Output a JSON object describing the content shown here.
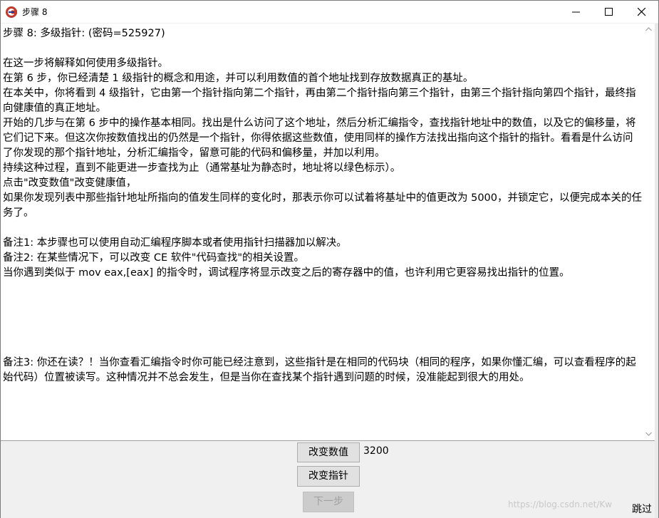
{
  "window": {
    "title": "步骤 8",
    "app_icon": "cheat-engine-logo-icon",
    "controls": {
      "minimize": "minimize-icon",
      "maximize": "maximize-icon",
      "close": "close-icon"
    }
  },
  "tutorial": {
    "text": "步骤 8: 多级指针: (密码=525927)\n\n在这一步将解释如何使用多级指针。\n在第 6 步，你已经清楚 1 级指针的概念和用途，并可以利用数值的首个地址找到存放数据真正的基址。\n在本关中，你将看到 4 级指针，它由第一个指针指向第二个指针，再由第二个指针指向第三个指针，由第三个指针指向第四个指针，最终指向健康值的真正地址。\n开始的几步与在第 6 步中的操作基本相同。找出是什么访问了这个地址，然后分析汇编指令，查找指针地址中的数值，以及它的偏移量，将它们记下来。但这次你按数值找出的仍然是一个指针，你得依据这些数值，使用同样的操作方法找出指向这个指针的指针。看看是什么访问了你发现的那个指针地址，分析汇编指令，留意可能的代码和偏移量，并加以利用。\n持续这种过程，直到不能更进一步查找为止（通常基址为静态时，地址将以绿色标示）。\n点击\"改变数值\"改变健康值，\n如果你发现列表中那些指针地址所指向的值发生同样的变化时，那表示你可以试着将基址中的值更改为 5000，并锁定它，以便完成本关的任务了。\n\n备注1: 本步骤也可以使用自动汇编程序脚本或者使用指针扫描器加以解决。\n备注2: 在某些情况下，可以改变 CE 软件\"代码查找\"的相关设置。\n当你遇到类似于 mov eax,[eax] 的指令时，调试程序将显示改变之后的寄存器中的值，也许利用它更容易找出指针的位置。\n\n\n\n\n\n备注3: 你还在读？！当你查看汇编指令时你可能已经注意到，这些指针是在相同的代码块（相同的程序，如果你懂汇编，可以查看程序的起始代码）位置被读写。这种情况并不总会发生，但是当你在查找某个指针遇到问题的时候，没准能起到很大的用处。"
  },
  "controls": {
    "change_value_label": "改变数值",
    "current_value": "3200",
    "change_pointer_label": "改变指针",
    "next_label": "下一步",
    "skip_label": "跳过"
  },
  "watermark": "https://blog.csdn.net/Kw",
  "scrollbar": {
    "up": "chevron-up-icon",
    "down": "chevron-down-icon"
  }
}
